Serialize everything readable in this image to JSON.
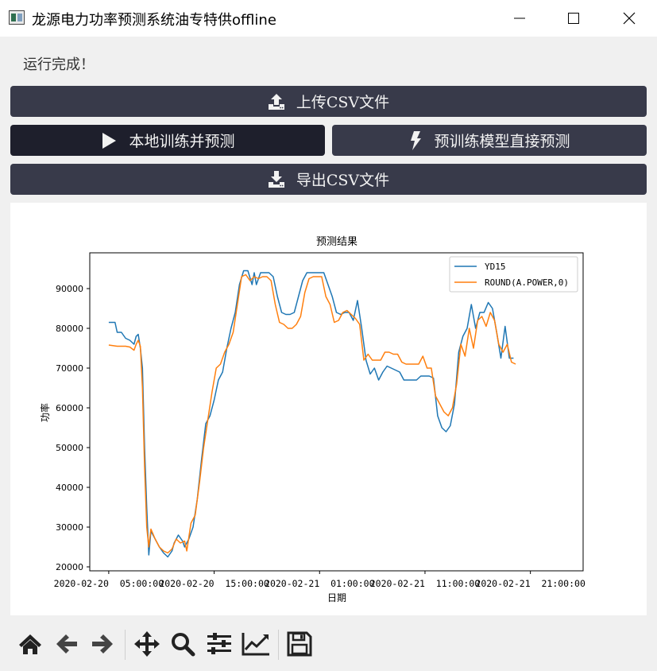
{
  "window": {
    "title": "龙源电力功率预测系统油专特供offline"
  },
  "status_text": "运行完成！",
  "buttons": {
    "upload": {
      "label": "上传CSV文件",
      "icon": "upload-icon"
    },
    "train": {
      "label": "本地训练并预测",
      "icon": "play-icon"
    },
    "pretrained": {
      "label": "预训练模型直接预测",
      "icon": "bolt-icon"
    },
    "export": {
      "label": "导出CSV文件",
      "icon": "download-icon"
    }
  },
  "chart_data": {
    "type": "line",
    "title": "预测结果",
    "xlabel": "日期",
    "ylabel": "功率",
    "ylim": [
      19000,
      99000
    ],
    "xlim": [
      -0.9,
      22.5
    ],
    "yticks": [
      20000,
      30000,
      40000,
      50000,
      60000,
      70000,
      80000,
      90000
    ],
    "xticks": [
      {
        "value": 0,
        "label": "2020-02-20  05:00:00"
      },
      {
        "value": 5,
        "label": "2020-02-20  15:00:00"
      },
      {
        "value": 10,
        "label": "2020-02-21  01:00:00"
      },
      {
        "value": 15,
        "label": "2020-02-21  11:00:00"
      },
      {
        "value": 20,
        "label": "2020-02-21  21:00:00"
      }
    ],
    "x_unit": "hours after 2020-02-20 05:00:00 (axis shows every 2 hours as 1 unit)",
    "legend_position": "upper right",
    "series": [
      {
        "name": "YD15",
        "color": "#1f77b4",
        "points": [
          [
            0.0,
            81500
          ],
          [
            0.3,
            81500
          ],
          [
            0.4,
            79000
          ],
          [
            0.6,
            79000
          ],
          [
            0.8,
            77500
          ],
          [
            1.0,
            77000
          ],
          [
            1.2,
            76000
          ],
          [
            1.3,
            78000
          ],
          [
            1.4,
            78500
          ],
          [
            1.5,
            75000
          ],
          [
            1.6,
            70000
          ],
          [
            1.7,
            50000
          ],
          [
            1.8,
            35000
          ],
          [
            1.9,
            23000
          ],
          [
            2.0,
            29000
          ],
          [
            2.2,
            27000
          ],
          [
            2.4,
            25000
          ],
          [
            2.6,
            23500
          ],
          [
            2.8,
            22500
          ],
          [
            3.0,
            24000
          ],
          [
            3.1,
            26000
          ],
          [
            3.3,
            28000
          ],
          [
            3.5,
            26500
          ],
          [
            3.6,
            25000
          ],
          [
            3.8,
            27000
          ],
          [
            4.0,
            30000
          ],
          [
            4.2,
            37000
          ],
          [
            4.4,
            47000
          ],
          [
            4.6,
            56000
          ],
          [
            4.8,
            58000
          ],
          [
            5.0,
            62000
          ],
          [
            5.2,
            67000
          ],
          [
            5.4,
            69000
          ],
          [
            5.6,
            75000
          ],
          [
            5.8,
            80000
          ],
          [
            6.0,
            84000
          ],
          [
            6.2,
            91000
          ],
          [
            6.4,
            94500
          ],
          [
            6.6,
            94500
          ],
          [
            6.8,
            91000
          ],
          [
            6.9,
            94000
          ],
          [
            7.0,
            91000
          ],
          [
            7.2,
            94000
          ],
          [
            7.4,
            94000
          ],
          [
            7.6,
            94000
          ],
          [
            7.8,
            93000
          ],
          [
            8.0,
            88000
          ],
          [
            8.2,
            84000
          ],
          [
            8.4,
            83500
          ],
          [
            8.6,
            83500
          ],
          [
            8.8,
            84000
          ],
          [
            9.0,
            88000
          ],
          [
            9.2,
            92000
          ],
          [
            9.4,
            94000
          ],
          [
            9.6,
            94000
          ],
          [
            9.8,
            94000
          ],
          [
            10.0,
            94000
          ],
          [
            10.2,
            94000
          ],
          [
            10.4,
            91000
          ],
          [
            10.6,
            88000
          ],
          [
            10.8,
            84000
          ],
          [
            11.0,
            83500
          ],
          [
            11.2,
            84000
          ],
          [
            11.4,
            84000
          ],
          [
            11.6,
            82000
          ],
          [
            11.8,
            87000
          ],
          [
            12.0,
            80000
          ],
          [
            12.2,
            72000
          ],
          [
            12.4,
            68500
          ],
          [
            12.6,
            70000
          ],
          [
            12.8,
            67000
          ],
          [
            13.0,
            69000
          ],
          [
            13.2,
            70500
          ],
          [
            13.4,
            70000
          ],
          [
            13.6,
            69500
          ],
          [
            13.8,
            69000
          ],
          [
            14.0,
            67000
          ],
          [
            14.2,
            67000
          ],
          [
            14.4,
            67000
          ],
          [
            14.6,
            67000
          ],
          [
            14.8,
            68000
          ],
          [
            15.0,
            68000
          ],
          [
            15.2,
            68000
          ],
          [
            15.4,
            67500
          ],
          [
            15.6,
            58000
          ],
          [
            15.8,
            55000
          ],
          [
            16.0,
            54000
          ],
          [
            16.2,
            55500
          ],
          [
            16.4,
            61000
          ],
          [
            16.6,
            74000
          ],
          [
            16.8,
            78000
          ],
          [
            17.0,
            80000
          ],
          [
            17.2,
            86000
          ],
          [
            17.4,
            80000
          ],
          [
            17.6,
            84000
          ],
          [
            17.8,
            84000
          ],
          [
            18.0,
            86500
          ],
          [
            18.2,
            85000
          ],
          [
            18.4,
            79000
          ],
          [
            18.6,
            72500
          ],
          [
            18.8,
            80500
          ],
          [
            19.0,
            72500
          ],
          [
            19.2,
            72500
          ]
        ]
      },
      {
        "name": "ROUND(A.POWER,0)",
        "color": "#ff7f0e",
        "points": [
          [
            0.0,
            75800
          ],
          [
            0.4,
            75500
          ],
          [
            0.8,
            75500
          ],
          [
            1.0,
            75300
          ],
          [
            1.2,
            74500
          ],
          [
            1.3,
            76000
          ],
          [
            1.4,
            77000
          ],
          [
            1.5,
            75500
          ],
          [
            1.6,
            65000
          ],
          [
            1.7,
            45000
          ],
          [
            1.8,
            30000
          ],
          [
            1.9,
            25000
          ],
          [
            2.0,
            29500
          ],
          [
            2.2,
            27000
          ],
          [
            2.4,
            25000
          ],
          [
            2.6,
            24000
          ],
          [
            2.8,
            23500
          ],
          [
            3.0,
            24500
          ],
          [
            3.2,
            27000
          ],
          [
            3.4,
            26000
          ],
          [
            3.6,
            26500
          ],
          [
            3.7,
            24000
          ],
          [
            3.9,
            31000
          ],
          [
            4.1,
            33000
          ],
          [
            4.3,
            41000
          ],
          [
            4.5,
            50000
          ],
          [
            4.7,
            57000
          ],
          [
            4.9,
            64000
          ],
          [
            5.1,
            70000
          ],
          [
            5.3,
            71000
          ],
          [
            5.5,
            74000
          ],
          [
            5.7,
            76000
          ],
          [
            5.9,
            79000
          ],
          [
            6.1,
            86000
          ],
          [
            6.3,
            93000
          ],
          [
            6.5,
            93500
          ],
          [
            6.7,
            92000
          ],
          [
            6.9,
            93000
          ],
          [
            7.1,
            92500
          ],
          [
            7.3,
            93000
          ],
          [
            7.5,
            93000
          ],
          [
            7.7,
            92000
          ],
          [
            7.9,
            86000
          ],
          [
            8.1,
            81500
          ],
          [
            8.3,
            81000
          ],
          [
            8.5,
            80000
          ],
          [
            8.7,
            80000
          ],
          [
            8.9,
            81000
          ],
          [
            9.1,
            83000
          ],
          [
            9.3,
            89000
          ],
          [
            9.5,
            92500
          ],
          [
            9.7,
            93000
          ],
          [
            9.9,
            93000
          ],
          [
            10.1,
            93000
          ],
          [
            10.3,
            88000
          ],
          [
            10.5,
            86000
          ],
          [
            10.7,
            81500
          ],
          [
            10.9,
            82000
          ],
          [
            11.1,
            84000
          ],
          [
            11.3,
            84500
          ],
          [
            11.5,
            83500
          ],
          [
            11.7,
            82500
          ],
          [
            11.9,
            81000
          ],
          [
            12.1,
            72000
          ],
          [
            12.3,
            73500
          ],
          [
            12.5,
            72000
          ],
          [
            12.7,
            72000
          ],
          [
            12.9,
            72000
          ],
          [
            13.1,
            74000
          ],
          [
            13.3,
            74000
          ],
          [
            13.5,
            73500
          ],
          [
            13.7,
            73500
          ],
          [
            13.9,
            71500
          ],
          [
            14.1,
            71000
          ],
          [
            14.3,
            71000
          ],
          [
            14.5,
            71000
          ],
          [
            14.7,
            71000
          ],
          [
            14.9,
            73000
          ],
          [
            15.1,
            70000
          ],
          [
            15.3,
            70000
          ],
          [
            15.5,
            63000
          ],
          [
            15.7,
            61000
          ],
          [
            15.9,
            59000
          ],
          [
            16.1,
            58000
          ],
          [
            16.3,
            60000
          ],
          [
            16.5,
            66000
          ],
          [
            16.7,
            76000
          ],
          [
            16.9,
            73000
          ],
          [
            17.1,
            80000
          ],
          [
            17.3,
            75000
          ],
          [
            17.5,
            82000
          ],
          [
            17.7,
            83000
          ],
          [
            17.9,
            80500
          ],
          [
            18.1,
            84000
          ],
          [
            18.3,
            82000
          ],
          [
            18.5,
            76000
          ],
          [
            18.7,
            74000
          ],
          [
            18.9,
            76000
          ],
          [
            19.1,
            71500
          ],
          [
            19.3,
            71000
          ]
        ]
      }
    ]
  },
  "toolbar": {
    "items": [
      "home-icon",
      "back-icon",
      "forward-icon",
      "pan-icon",
      "zoom-icon",
      "configure-subplots-icon",
      "edit-axis-icon",
      "save-icon"
    ]
  }
}
